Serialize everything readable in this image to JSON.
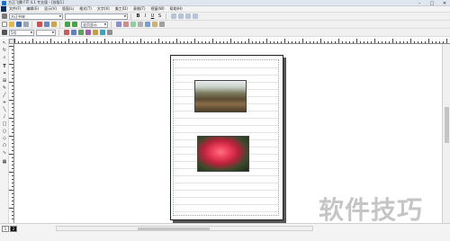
{
  "window": {
    "title": "方正飞腾 FIT 4.1 专业版 - [排版1]",
    "minimize": "–",
    "maximize": "□",
    "close": "✕"
  },
  "menu": {
    "items": [
      "文件(F)",
      "编辑(E)",
      "显示(V)",
      "版面(L)",
      "格式(T)",
      "文字(X)",
      "美工(D)",
      "表格(T)",
      "视窗(W)",
      "帮助(H)"
    ]
  },
  "toolbar": {
    "font_cn": "方正书宋",
    "font_en": "",
    "size": "5号",
    "size2": "",
    "zoom": "全页显示",
    "style_buttons": [
      "B",
      "I",
      "U",
      "S"
    ]
  },
  "page_tabs": [
    "1",
    "2"
  ],
  "watermark": "软件技巧",
  "colors": {
    "titlebar": "#dfe6ee",
    "page_border": "#222222",
    "gridline": "#dde6e0"
  }
}
